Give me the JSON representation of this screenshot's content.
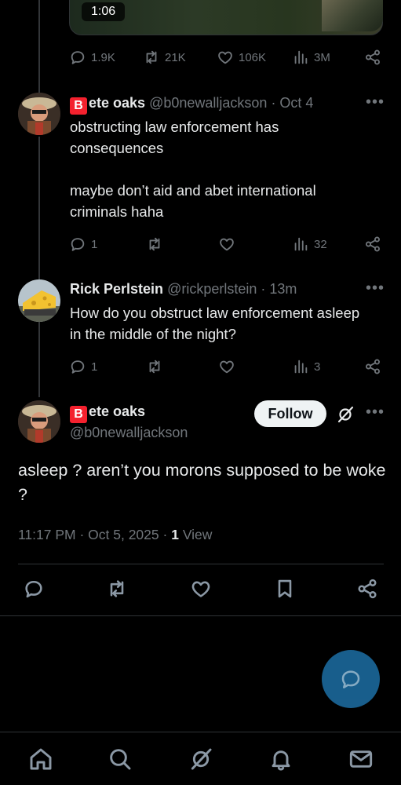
{
  "video": {
    "duration": "1:06"
  },
  "top_post_stats": {
    "replies": "1.9K",
    "reposts": "21K",
    "likes": "106K",
    "views": "3M"
  },
  "reply1": {
    "name_initial": "B",
    "name_rest": "ete oaks",
    "handle": "@b0newalljackson",
    "date": "· Oct 4",
    "paragraph1": "obstructing law enforcement has consequences",
    "paragraph2": "maybe don’t aid and abet international criminals haha",
    "replies": "1",
    "views": "32"
  },
  "reply2": {
    "name": "Rick Perlstein",
    "handle": "@rickperlstein",
    "time": "· 13m",
    "text": "How do you obstruct law enforcement asleep in the middle of the night?",
    "replies": "1",
    "views": "3"
  },
  "main": {
    "name_initial": "B",
    "name_rest": "ete oaks",
    "handle": "@b0newalljackson",
    "follow_label": "Follow",
    "text": "asleep ? aren’t you morons supposed to be woke ?",
    "timestamp": "11:17 PM · Oct 5, 2025 ·",
    "view_count": "1",
    "view_label": "View"
  },
  "more_label": "•••",
  "icons": {
    "reply": "reply-icon",
    "repost": "repost-icon",
    "like": "like-icon",
    "views": "views-icon",
    "share": "share-icon",
    "bookmark": "bookmark-icon",
    "grok": "grok-icon",
    "home": "home-icon",
    "search": "search-icon",
    "notifications": "bell-icon",
    "messages": "mail-icon"
  },
  "colors": {
    "background": "#000000",
    "accent": "#1d9bf0",
    "fab": "#1d6fa5",
    "badge": "#f4212e"
  }
}
